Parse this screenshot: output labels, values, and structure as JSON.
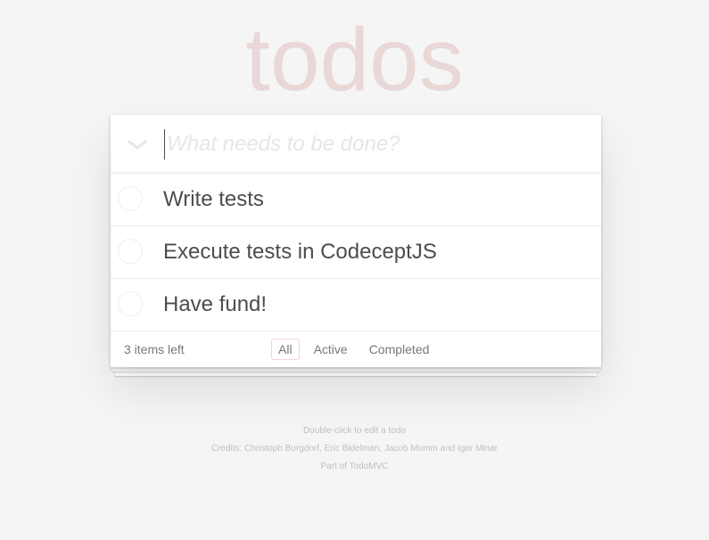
{
  "app": {
    "title": "todos"
  },
  "header": {
    "toggle_all_icon": "chevron-down",
    "new_todo_placeholder": "What needs to be done?",
    "new_todo_value": ""
  },
  "todos": [
    {
      "label": "Write tests",
      "completed": false
    },
    {
      "label": "Execute tests in CodeceptJS",
      "completed": false
    },
    {
      "label": "Have fund!",
      "completed": false
    }
  ],
  "footer": {
    "count_text": "3 items left",
    "filters": [
      {
        "label": "All",
        "selected": true
      },
      {
        "label": "Active",
        "selected": false
      },
      {
        "label": "Completed",
        "selected": false
      }
    ]
  },
  "info": {
    "hint": "Double-click to edit a todo",
    "credits": "Credits: Christoph Burgdorf, Eric Bidelman, Jacob Mumm and Igor Minar",
    "part_of": "Part of TodoMVC"
  },
  "colors": {
    "title": "#ead7d7",
    "background": "#f5f5f5",
    "text": "#4d4d4d",
    "selected_filter_border": "#efd5d5"
  }
}
